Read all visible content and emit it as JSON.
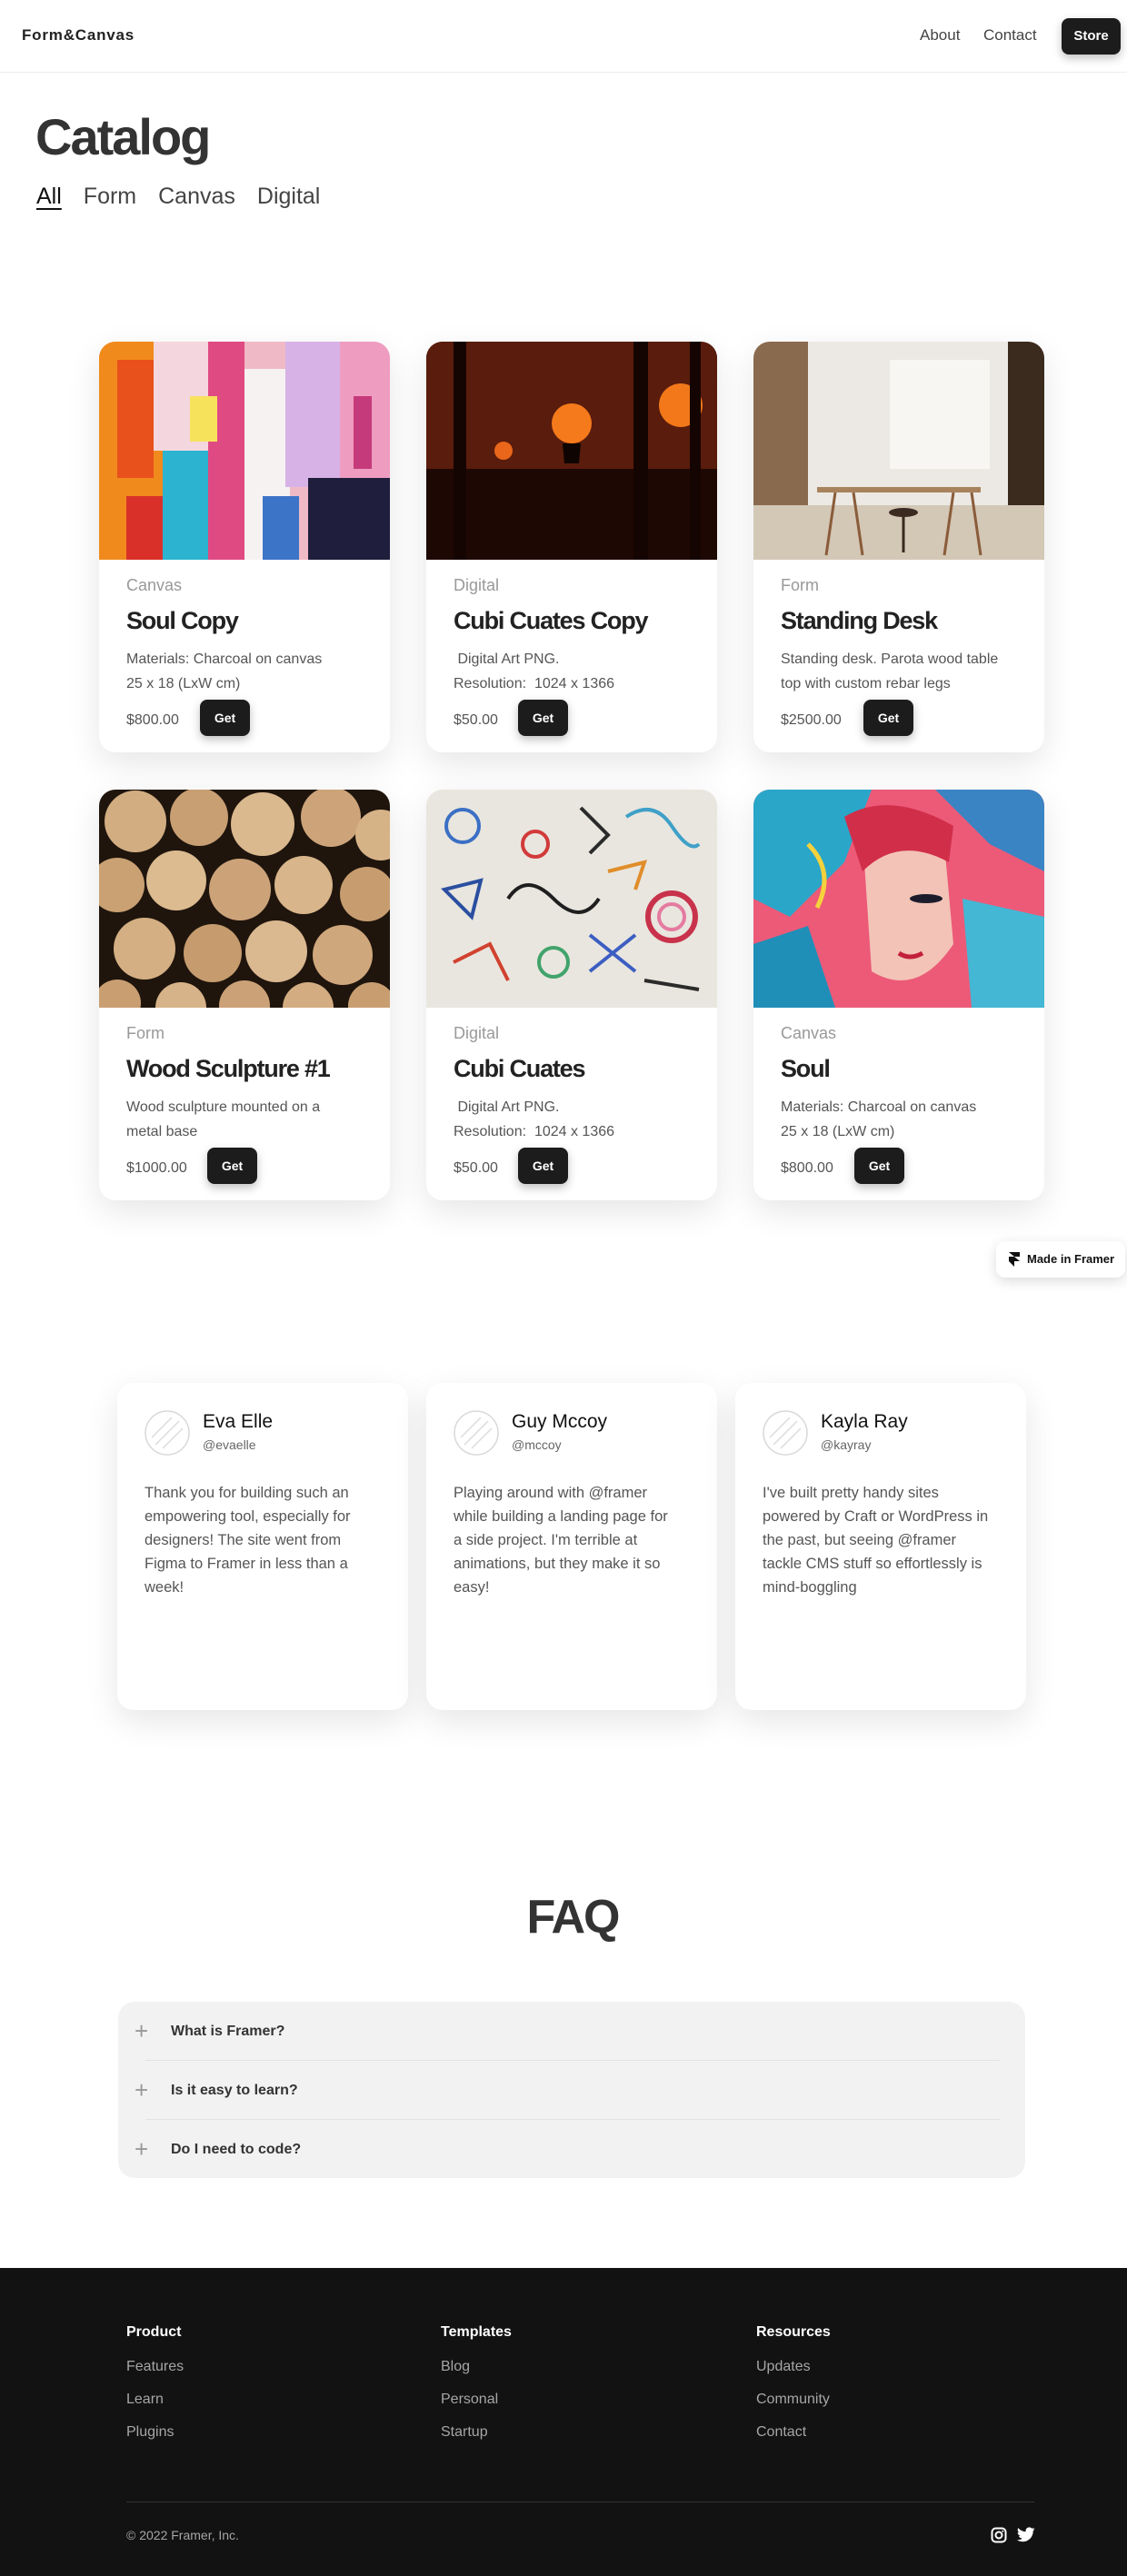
{
  "nav": {
    "brand": "Form&Canvas",
    "links": [
      "About",
      "Contact"
    ],
    "store_label": "Store"
  },
  "catalog": {
    "title": "Catalog",
    "filters": [
      "All",
      "Form",
      "Canvas",
      "Digital"
    ],
    "active_filter": "All"
  },
  "products": [
    {
      "category": "Canvas",
      "name": "Soul Copy",
      "desc_lines": [
        "Materials: Charcoal on canvas",
        "25 x 18 (LxW cm)"
      ],
      "price": "$800.00",
      "button": "Get",
      "image": "abstract-paint-image"
    },
    {
      "category": "Digital",
      "name": "Cubi Cuates Copy",
      "desc_lines": [
        " Digital Art PNG.",
        "Resolution:  1024 x 1366"
      ],
      "price": "$50.00",
      "button": "Get",
      "image": "deer-sunset-image"
    },
    {
      "category": "Form",
      "name": "Standing Desk",
      "desc_lines": [
        "Standing desk. Parota wood table",
        "top with custom rebar legs"
      ],
      "price": "$2500.00",
      "button": "Get",
      "image": "desk-room-image"
    },
    {
      "category": "Form",
      "name": "Wood Sculpture #1",
      "desc_lines": [
        "Wood sculpture mounted on a",
        "metal base"
      ],
      "price": "$1000.00",
      "button": "Get",
      "image": "wood-logs-image"
    },
    {
      "category": "Digital",
      "name": "Cubi Cuates",
      "desc_lines": [
        " Digital Art PNG.",
        "Resolution:  1024 x 1366"
      ],
      "price": "$50.00",
      "button": "Get",
      "image": "doodle-art-image"
    },
    {
      "category": "Canvas",
      "name": "Soul",
      "desc_lines": [
        "Materials: Charcoal on canvas",
        "25 x 18 (LxW cm)"
      ],
      "price": "$800.00",
      "button": "Get",
      "image": "watercolor-face-image"
    }
  ],
  "badge": {
    "label": "Made in Framer",
    "icon": "framer-icon"
  },
  "testimonials": [
    {
      "name": "Eva Elle",
      "handle": "@evaelle",
      "text_lines": [
        "Thank you for building such an",
        "empowering tool, especially for",
        "designers! The site went from",
        "Figma to Framer in less than a",
        "week!"
      ]
    },
    {
      "name": "Guy Mccoy",
      "handle": "@mccoy",
      "text_lines": [
        "Playing around with @framer",
        "while building a landing page for",
        "a side project. I'm terrible at",
        "animations, but they make it so",
        "easy!"
      ]
    },
    {
      "name": "Kayla Ray",
      "handle": "@kayray",
      "text_lines": [
        "I've built pretty handy sites",
        "powered by Craft or WordPress in",
        "the past, but seeing @framer",
        "tackle CMS stuff so effortlessly is",
        "mind-boggling"
      ]
    }
  ],
  "faq": {
    "title": "FAQ",
    "items": [
      "What is Framer?",
      "Is it easy to learn?",
      "Do I need to code?"
    ]
  },
  "footer": {
    "columns": [
      {
        "heading": "Product",
        "links": [
          "Features",
          "Learn",
          "Plugins"
        ]
      },
      {
        "heading": "Templates",
        "links": [
          "Blog",
          "Personal",
          "Startup"
        ]
      },
      {
        "heading": "Resources",
        "links": [
          "Updates",
          "Community",
          "Contact"
        ]
      }
    ],
    "copyright": "© 2022 Framer, Inc.",
    "social_icons": [
      "instagram-icon",
      "twitter-icon"
    ]
  },
  "colors": {
    "accent": "#1c1c1c",
    "footer_bg": "#121212",
    "faq_bg": "#f2f2f2"
  }
}
